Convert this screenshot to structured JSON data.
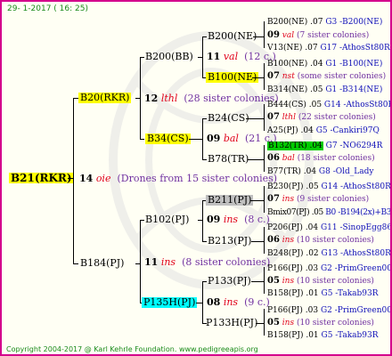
{
  "header": "29-  1-2017  ( 16: 25)",
  "footer": "Copyright 2004-2017 @ Karl Kehrle Foundation.   www.pedigreeapis.org",
  "colors": {
    "frame": "#d4008c",
    "yellow": "#ffff00",
    "cyan": "#00ffff",
    "gray": "#c0c0c0",
    "green": "#00cc00"
  },
  "root": {
    "label": "B21(RKR)",
    "gen": "14",
    "gen_code": "oie",
    "note": "(Drones from 15 sister colonies)"
  },
  "g1": {
    "top": {
      "label": "B20(RKR)",
      "gen": "12",
      "gen_code": "lthl",
      "note": "(28 sister colonies)"
    },
    "bottom": {
      "label": "B184(PJ)",
      "gen": "11",
      "gen_code": "ins",
      "note": "(8 sister colonies)"
    }
  },
  "g2": {
    "a": {
      "label": "B200(BB)",
      "gen": "11",
      "gen_code": "val",
      "note": "(12 c.)"
    },
    "b": {
      "label": "B34(CS)",
      "gen": "09",
      "gen_code": "bal",
      "note": "(21 c.)"
    },
    "c": {
      "label": "B102(PJ)",
      "gen": "09",
      "gen_code": "ins",
      "note": "(8 c.)"
    },
    "d": {
      "label": "P135H(PJ)",
      "gen": "08",
      "gen_code": "ins",
      "note": "(9 c.)"
    }
  },
  "g3": [
    {
      "label": "B200(NE)"
    },
    {
      "label": "B100(NE)"
    },
    {
      "label": "B24(CS)"
    },
    {
      "label": "B78(TR)"
    },
    {
      "label": "B211(PJ)"
    },
    {
      "label": "B213(PJ)"
    },
    {
      "label": "P133(PJ)"
    },
    {
      "label": "P133H(PJ)"
    }
  ],
  "g4": [
    {
      "sire": "B200(NE) .07",
      "sire_tail": "G3 -B200(NE)",
      "gen": "09",
      "gen_code": "val",
      "note": "(7 sister colonies)",
      "dam": "V13(NE) .07",
      "dam_tail": "G17 -AthosSt80R"
    },
    {
      "sire": "B100(NE) .04",
      "sire_tail": "G1 -B100(NE)",
      "gen": "07",
      "gen_code": "nst",
      "note": "(some sister colonies)",
      "dam": "B314(NE) .05",
      "dam_tail": "G1 -B314(NE)"
    },
    {
      "sire": "B444(CS) .05",
      "sire_tail": "G14 -AthosSt80R",
      "gen": "07",
      "gen_code": "lthl",
      "note": "(22 sister colonies)",
      "dam": "A25(PJ) .04",
      "dam_tail": "G5 -Cankiri97Q"
    },
    {
      "sire": "B132(TR) .04",
      "sire_tail": "G7 -NO6294R",
      "gen": "06",
      "gen_code": "bal",
      "note": "(18 sister colonies)",
      "dam": "B77(TR) .04",
      "dam_tail": "G8 -Old_Lady"
    },
    {
      "sire": "B230(PJ) .05",
      "sire_tail": "G14 -AthosSt80R",
      "gen": "07",
      "gen_code": "ins",
      "note": "(9 sister colonies)",
      "dam": "Bmix07(PJ) .05",
      "dam_tail": "B0 -B194(2x)+B3"
    },
    {
      "sire": "P206(PJ) .04",
      "sire_tail": "G11 -SinopEgg86R",
      "gen": "06",
      "gen_code": "ins",
      "note": "(10 sister colonies)",
      "dam": "B248(PJ) .02",
      "dam_tail": "G13 -AthosSt80R"
    },
    {
      "sire": "P166(PJ) .03",
      "sire_tail": "G2 -PrimGreen00",
      "gen": "05",
      "gen_code": "ins",
      "note": "(10 sister colonies)",
      "dam": "B158(PJ) .01",
      "dam_tail": "G5 -Takab93R"
    },
    {
      "sire": "P166(PJ) .03",
      "sire_tail": "G2 -PrimGreen00",
      "gen": "05",
      "gen_code": "ins",
      "note": "(10 sister colonies)",
      "dam": "B158(PJ) .01",
      "dam_tail": "G5 -Takab93R"
    }
  ]
}
